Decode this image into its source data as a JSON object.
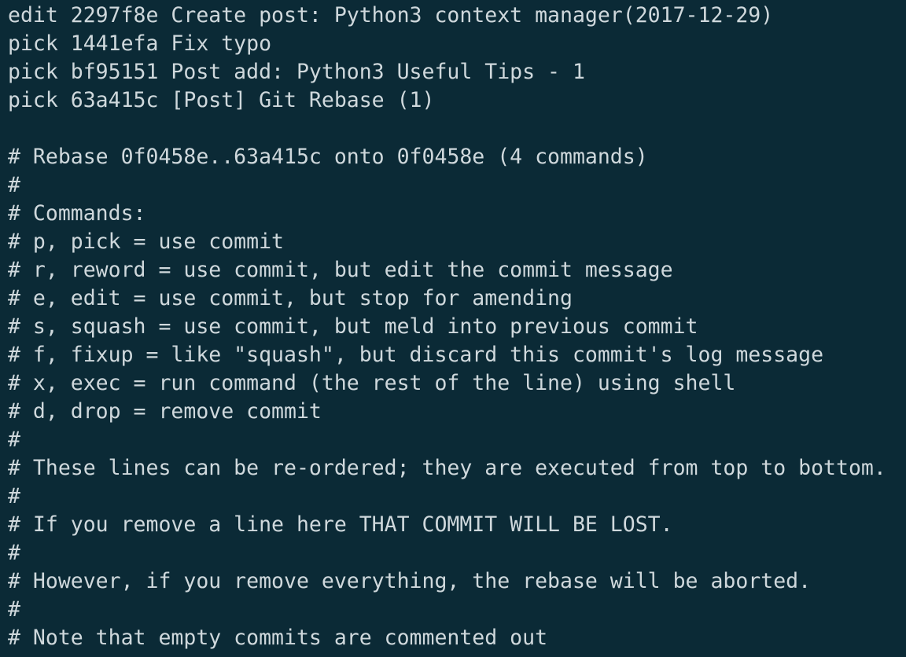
{
  "editor": {
    "lines": [
      "edit 2297f8e Create post: Python3 context manager(2017-12-29)",
      "pick 1441efa Fix typo",
      "pick bf95151 Post add: Python3 Useful Tips - 1",
      "pick 63a415c [Post] Git Rebase (1)",
      "",
      "# Rebase 0f0458e..63a415c onto 0f0458e (4 commands)",
      "#",
      "# Commands:",
      "# p, pick = use commit",
      "# r, reword = use commit, but edit the commit message",
      "# e, edit = use commit, but stop for amending",
      "# s, squash = use commit, but meld into previous commit",
      "# f, fixup = like \"squash\", but discard this commit's log message",
      "# x, exec = run command (the rest of the line) using shell",
      "# d, drop = remove commit",
      "#",
      "# These lines can be re-ordered; they are executed from top to bottom.",
      "#",
      "# If you remove a line here THAT COMMIT WILL BE LOST.",
      "#",
      "# However, if you remove everything, the rebase will be aborted.",
      "#",
      "# Note that empty commits are commented out"
    ]
  },
  "colors": {
    "background": "#0b2a36",
    "text": "#cfd8dc"
  }
}
